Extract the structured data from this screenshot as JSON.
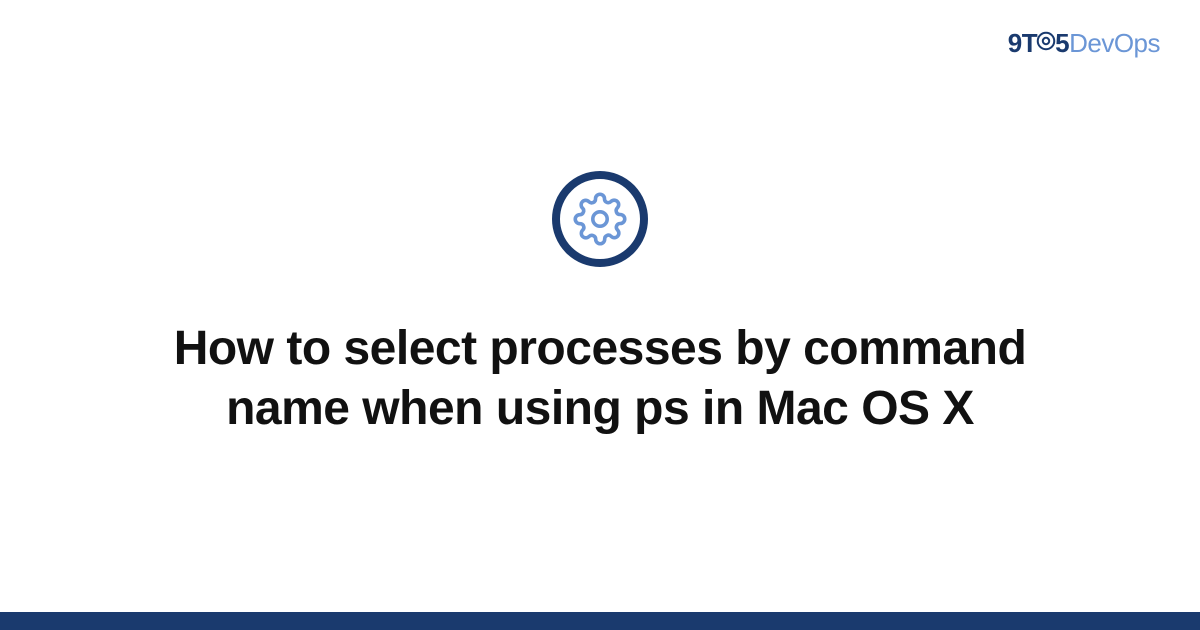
{
  "logo": {
    "part1": "9T",
    "part2": "5",
    "part3": "DevOps"
  },
  "icon": {
    "name": "gear-icon"
  },
  "title": "How to select processes by command name when using ps in Mac OS X",
  "colors": {
    "brand_dark": "#1a3a6e",
    "brand_light": "#6b96d6"
  }
}
